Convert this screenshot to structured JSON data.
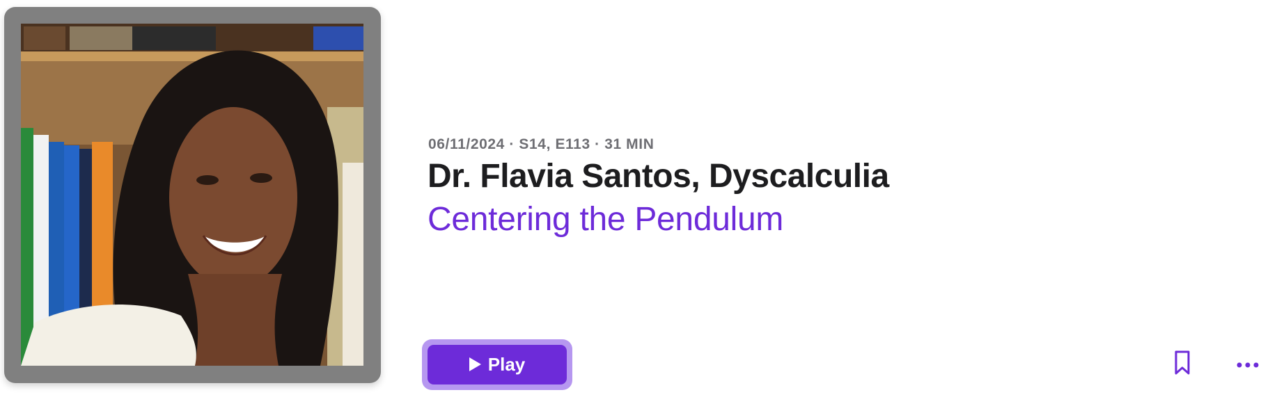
{
  "artwork": {
    "alt": "Dr. Flavia Santos"
  },
  "episode": {
    "meta": "06/11/2024 · S14, E113 · 31 MIN",
    "title": "Dr. Flavia Santos, Dyscalculia",
    "show": "Centering the Pendulum"
  },
  "actions": {
    "play_label": "Play",
    "play_icon": "play-triangle",
    "bookmark_icon": "bookmark-outline",
    "more_icon": "ellipsis"
  },
  "colors": {
    "accent": "#6d2bd9",
    "accent_focus": "#b697f0",
    "title": "#1d1d1f",
    "meta": "#6e6e73",
    "artwork_frame": "#808080"
  }
}
